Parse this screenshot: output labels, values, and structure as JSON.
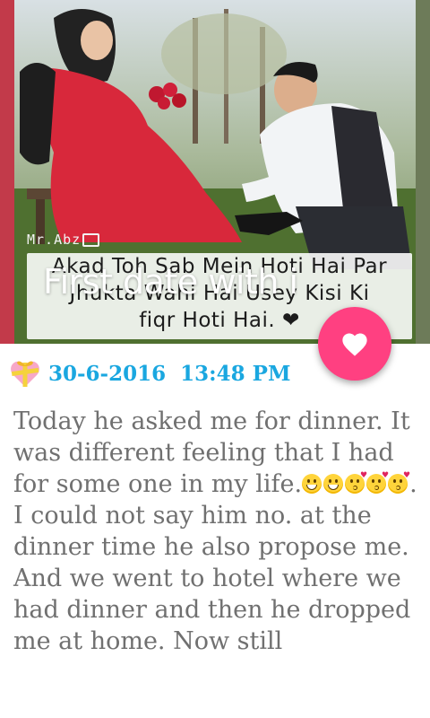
{
  "hero": {
    "title": "First date with i",
    "watermark": "Mr.Abz",
    "caption_lines": [
      "Akad Toh Sab Mein Hoti Hai Par",
      "Jhukta Wahi Hai Usey Kisi Ki",
      "fiqr Hoti Hai. ❤"
    ]
  },
  "fab": {
    "icon": "heart-icon",
    "color": "#ff4081"
  },
  "entry": {
    "date": "30-6-2016",
    "time": "13:48 PM",
    "date_icon": "gift-heart-icon",
    "date_color": "#1aa7e0",
    "paragraphs": {
      "p1": "Today he asked me for dinner. It was different feeling that I had for some one in my life.",
      "p1_end": ".",
      "p2": "I could not say him no. at the dinner time he also propose me.",
      "p3": "And we went to hotel where we had dinner and then he dropped me at home. Now still"
    },
    "text_color": "#707070"
  }
}
